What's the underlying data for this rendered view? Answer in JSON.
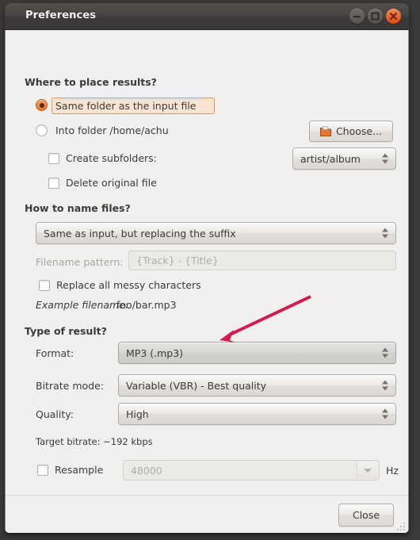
{
  "window": {
    "title": "Preferences",
    "controls": [
      {
        "name": "minimize",
        "glyph": "minimize-icon"
      },
      {
        "name": "maximize",
        "glyph": "maximize-icon"
      },
      {
        "name": "close",
        "glyph": "close-icon"
      }
    ]
  },
  "sections": {
    "where": {
      "heading": "Where to place results?",
      "radio_same_folder": "Same folder as the input file",
      "radio_into_folder": "Into folder /home/achu",
      "choose_button": "Choose...",
      "create_subfolders": "Create subfolders:",
      "subfolders_value": "artist/album",
      "delete_original": "Delete original file"
    },
    "naming": {
      "heading": "How to name files?",
      "scheme_value": "Same as input, but replacing the suffix",
      "pattern_label": "Filename pattern:",
      "pattern_placeholder": "{Track} - {Title}",
      "replace_messy": "Replace all messy characters",
      "example_label": "Example filename:",
      "example_value": "foo/bar.mp3"
    },
    "result": {
      "heading": "Type of result?",
      "format_label": "Format:",
      "format_value": "MP3 (.mp3)",
      "bitrate_label": "Bitrate mode:",
      "bitrate_value": "Variable (VBR) - Best quality",
      "quality_label": "Quality:",
      "quality_value": "High",
      "target_bitrate": "Target bitrate: ~192 kbps",
      "resample_label": "Resample",
      "resample_value": "48000",
      "hz_label": "Hz"
    }
  },
  "footer": {
    "close_button": "Close"
  },
  "colors": {
    "accent_orange": "#e4762c",
    "close_button": "#dd4814",
    "annotation_arrow": "#d01c4e",
    "dialog_bg": "#f2f0ee",
    "text": "#3c3b37",
    "text_disabled": "#a9a6a2"
  },
  "annotation": {
    "name": "pointer-arrow",
    "target": "format-combobox",
    "color": "#d01c4e"
  }
}
